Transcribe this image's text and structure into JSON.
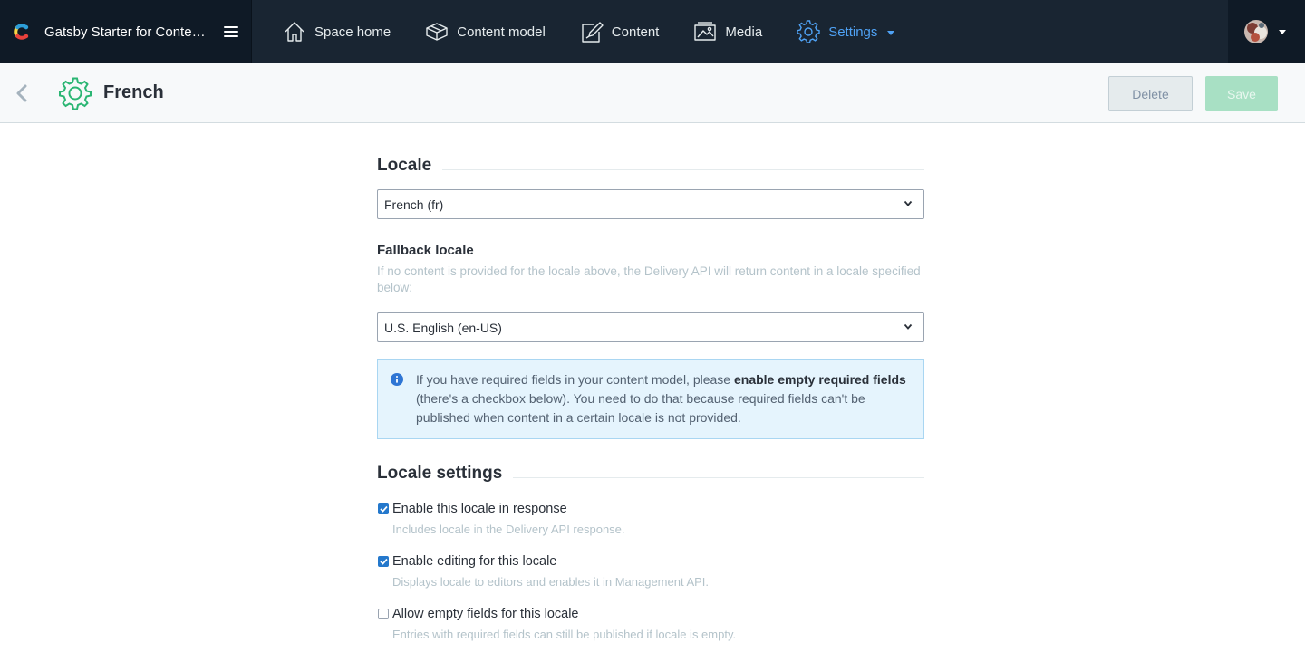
{
  "app": {
    "space_name": "Gatsby Starter for Contentful",
    "nav": [
      {
        "label": "Space home",
        "icon": "home-icon"
      },
      {
        "label": "Content model",
        "icon": "content-model-icon"
      },
      {
        "label": "Content",
        "icon": "content-icon"
      },
      {
        "label": "Media",
        "icon": "media-icon"
      },
      {
        "label": "Settings",
        "icon": "gear-icon",
        "active": true
      }
    ]
  },
  "header": {
    "title": "French",
    "delete_label": "Delete",
    "save_label": "Save"
  },
  "locale_section": {
    "heading": "Locale",
    "selected": "French (fr)"
  },
  "fallback": {
    "label": "Fallback locale",
    "help": "If no content is provided for the locale above, the Delivery API will return content in a locale specified below:",
    "selected": "U.S. English (en-US)"
  },
  "note": {
    "text_1": "If you have required fields in your content model, please ",
    "bold": "enable empty required fields",
    "text_2": " (there's a checkbox below). You need to do that because required fields can't be published when content in a certain locale is not provided."
  },
  "settings_section": {
    "heading": "Locale settings",
    "options": [
      {
        "label": "Enable this locale in response",
        "help": "Includes locale in the Delivery API response.",
        "checked": true
      },
      {
        "label": "Enable editing for this locale",
        "help": "Displays locale to editors and enables it in Management API.",
        "checked": true
      },
      {
        "label": "Allow empty fields for this locale",
        "help": "Entries with required fields can still be published if locale is empty.",
        "checked": false
      }
    ]
  },
  "colors": {
    "topbar": "#192532",
    "active_nav": "#4fa2f5",
    "checkbox_checked": "#2478cc",
    "save_disabled": "#a8e0c4",
    "note_bg": "#e5f4fd"
  }
}
